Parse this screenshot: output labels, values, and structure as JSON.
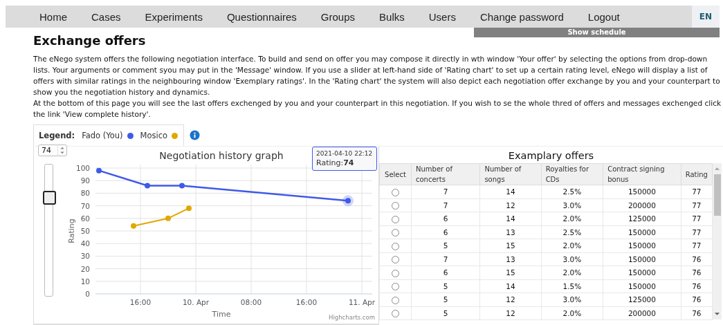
{
  "nav": {
    "items": [
      {
        "label": "Home"
      },
      {
        "label": "Cases"
      },
      {
        "label": "Experiments"
      },
      {
        "label": "Questionnaires"
      },
      {
        "label": "Groups"
      },
      {
        "label": "Bulks"
      },
      {
        "label": "Users"
      },
      {
        "label": "Change password"
      },
      {
        "label": "Logout"
      }
    ],
    "language": "EN"
  },
  "schedule_button": "Show schedule",
  "page_title": "Exchange offers",
  "intro": [
    "The eNego system offers the following negotiation interface. To build and send on offer you may compose it directly in wth window 'Your offer' by selecting the options from drop-down lists. Your arguments or comment syou may put in the 'Message' window. If you use a slider at left-hand side of 'Rating chart' to set up a certain rating level, eNego will display a list of offers with similar ratings in the neighbouring window 'Exemplary ratings'. In the 'Rating chart' the system will also depict each negotiation offer exchange by you and your counterpart to show you the negotiation history and dynamics.",
    "At the bottom of this page you will see the last offers exchenged by you and your counterpart in this negotiation. If you wish to se the whole thred of offers and messages exchenged click the link 'View complete history'."
  ],
  "legend": {
    "label": "Legend:"
  },
  "rating_input": {
    "value": "74"
  },
  "rating_slider": {
    "level": 0.74
  },
  "chart_data": {
    "type": "line",
    "title": "Negotiation history graph",
    "xlabel": "Time",
    "ylabel": "Rating",
    "ylim": [
      0,
      100
    ],
    "grid": true,
    "categories": [
      null,
      null,
      null,
      null,
      null,
      null,
      "16:00",
      null,
      null,
      null,
      null,
      null,
      null,
      null,
      "10. Apr",
      null,
      null,
      null,
      null,
      null,
      null,
      null,
      "08:00",
      null,
      null,
      null,
      null,
      null,
      null,
      null,
      "16:00",
      null,
      null,
      null,
      null,
      null,
      null,
      null,
      "11. Apr",
      null
    ],
    "yticks": [
      0,
      10,
      20,
      30,
      40,
      50,
      60,
      70,
      80,
      90,
      100
    ],
    "series": [
      {
        "name": "Fado (You)",
        "color": "#3f5ae8",
        "marker": true,
        "values": [
          98,
          null,
          null,
          null,
          null,
          null,
          null,
          86,
          null,
          null,
          null,
          null,
          86,
          null,
          null,
          null,
          null,
          null,
          null,
          null,
          null,
          null,
          null,
          null,
          null,
          null,
          null,
          null,
          null,
          null,
          null,
          null,
          null,
          null,
          null,
          null,
          74,
          null,
          null,
          null
        ]
      },
      {
        "name": "Mosico",
        "color": "#e0a800",
        "marker": true,
        "values": [
          null,
          null,
          null,
          null,
          null,
          54,
          null,
          null,
          null,
          null,
          60,
          null,
          null,
          68,
          null,
          null,
          null,
          null,
          null,
          null,
          null,
          null,
          null,
          null,
          null,
          null,
          null,
          null,
          null,
          null,
          null,
          null,
          null,
          null,
          null,
          null,
          null,
          null,
          null,
          null
        ]
      }
    ],
    "annotations": [
      "2021-04-10 22:12",
      "Rating:**74**"
    ]
  },
  "chart_credit": "Highcharts.com",
  "offers": {
    "title": "Examplary offers",
    "columns": [
      "Select",
      "Number of concerts",
      "Number of songs",
      "Royalties for CDs",
      "Contract signing bonus",
      "Rating"
    ],
    "rows": [
      {
        "selected": false,
        "cells": [
          "",
          "7",
          "14",
          "2.5%",
          "150000",
          "77"
        ]
      },
      {
        "selected": false,
        "cells": [
          "",
          "7",
          "12",
          "3.0%",
          "200000",
          "77"
        ]
      },
      {
        "selected": false,
        "cells": [
          "",
          "6",
          "14",
          "2.0%",
          "125000",
          "77"
        ]
      },
      {
        "selected": false,
        "cells": [
          "",
          "6",
          "13",
          "2.5%",
          "150000",
          "77"
        ]
      },
      {
        "selected": false,
        "cells": [
          "",
          "5",
          "15",
          "2.0%",
          "150000",
          "77"
        ]
      },
      {
        "selected": false,
        "cells": [
          "",
          "7",
          "13",
          "3.0%",
          "150000",
          "76"
        ]
      },
      {
        "selected": false,
        "cells": [
          "",
          "6",
          "15",
          "2.0%",
          "150000",
          "76"
        ]
      },
      {
        "selected": false,
        "cells": [
          "",
          "5",
          "14",
          "1.5%",
          "150000",
          "76"
        ]
      },
      {
        "selected": false,
        "cells": [
          "",
          "5",
          "12",
          "3.0%",
          "125000",
          "76"
        ]
      },
      {
        "selected": false,
        "cells": [
          "",
          "5",
          "12",
          "2.0%",
          "200000",
          "76"
        ]
      }
    ]
  }
}
